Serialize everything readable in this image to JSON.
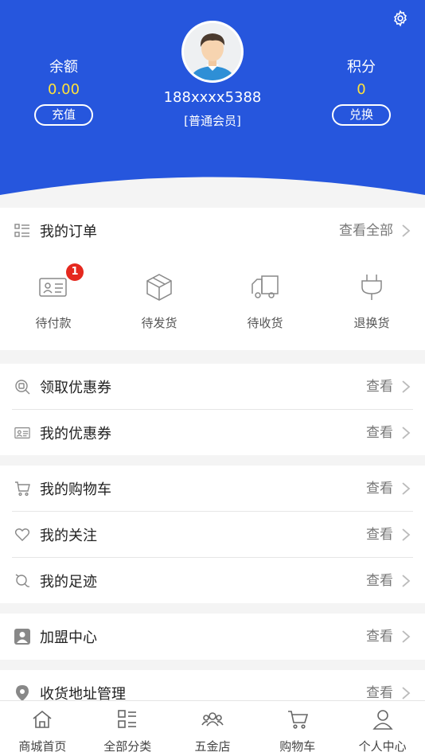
{
  "header": {
    "balance_label": "余额",
    "balance_value": "0.00",
    "recharge_label": "充值",
    "points_label": "积分",
    "points_value": "0",
    "exchange_label": "兑换",
    "phone": "188xxxx5388",
    "member_level": "[普通会员]",
    "brand_color": "#2656dd",
    "value_color": "#ffe23b"
  },
  "orders": {
    "title": "我的订单",
    "view_all": "查看全部",
    "items": [
      {
        "label": "待付款",
        "icon": "wallet-card-icon",
        "badge": "1"
      },
      {
        "label": "待发货",
        "icon": "box-icon"
      },
      {
        "label": "待收货",
        "icon": "truck-icon"
      },
      {
        "label": "退换货",
        "icon": "plug-icon"
      }
    ]
  },
  "coupons": [
    {
      "title": "领取优惠券",
      "more": "查看",
      "icon": "coupon-search-icon"
    },
    {
      "title": "我的优惠券",
      "more": "查看",
      "icon": "id-card-icon"
    }
  ],
  "shopping": [
    {
      "title": "我的购物车",
      "more": "查看",
      "icon": "cart-icon"
    },
    {
      "title": "我的关注",
      "more": "查看",
      "icon": "heart-icon"
    },
    {
      "title": "我的足迹",
      "more": "查看",
      "icon": "footprint-icon"
    }
  ],
  "franchise": {
    "title": "加盟中心",
    "more": "查看",
    "icon": "user-icon"
  },
  "address": {
    "title": "收货地址管理",
    "more": "查看",
    "icon": "location-pin-icon"
  },
  "tabbar": [
    {
      "label": "商城首页",
      "icon": "home-icon"
    },
    {
      "label": "全部分类",
      "icon": "category-icon"
    },
    {
      "label": "五金店",
      "icon": "group-icon"
    },
    {
      "label": "购物车",
      "icon": "cart-icon"
    },
    {
      "label": "个人中心",
      "icon": "person-icon"
    }
  ]
}
